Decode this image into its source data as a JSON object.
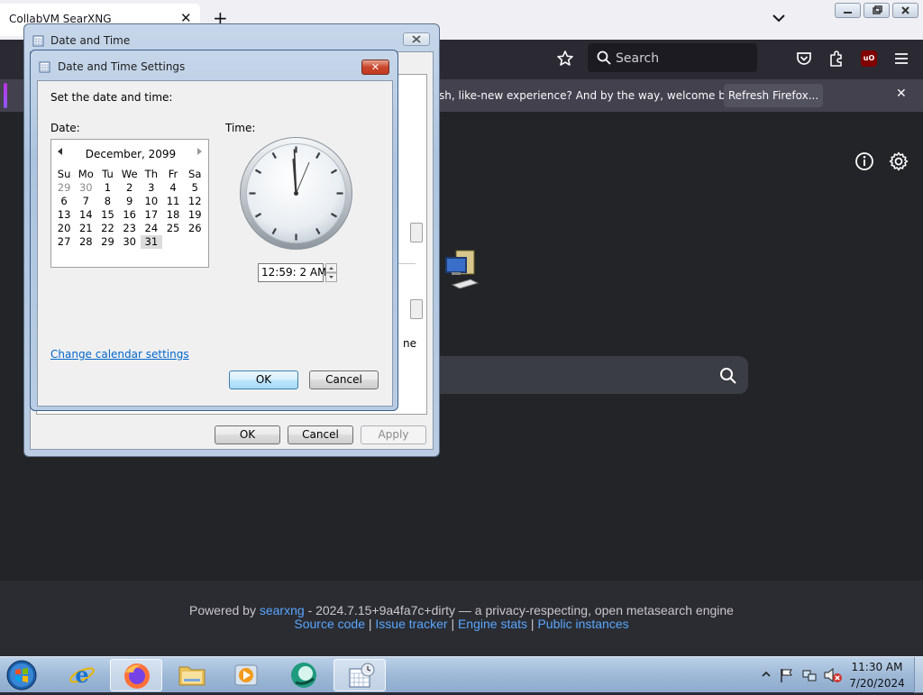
{
  "browser": {
    "tab_title": "CollabVM SearXNG",
    "search_placeholder": "Search",
    "ublock_label": "uO",
    "notification_text": "sh, like-new experience? And by the way, welcome back!",
    "refresh_button": "Refresh Firefox..."
  },
  "searxng": {
    "footer_prefix": "Powered by",
    "footer_link": "searxng",
    "footer_suffix": "- 2024.7.15+9a4fa7c+dirty — a privacy-respecting, open metasearch engine",
    "links": [
      "Source code",
      "Issue tracker",
      "Engine stats",
      "Public instances"
    ],
    "separator": "|"
  },
  "dialog_outer": {
    "title": "Date and Time",
    "partial_text": "ne",
    "ok": "OK",
    "cancel": "Cancel",
    "apply": "Apply"
  },
  "dialog_settings": {
    "title": "Date and Time Settings",
    "close_glyph": "✕",
    "prompt": "Set the date and time:",
    "date_label": "Date:",
    "time_label": "Time:",
    "calendar": {
      "month_year": "December, 2099",
      "weekdays": [
        "Su",
        "Mo",
        "Tu",
        "We",
        "Th",
        "Fr",
        "Sa"
      ],
      "weeks": [
        [
          "29",
          "30",
          "1",
          "2",
          "3",
          "4",
          "5"
        ],
        [
          "6",
          "7",
          "8",
          "9",
          "10",
          "11",
          "12"
        ],
        [
          "13",
          "14",
          "15",
          "16",
          "17",
          "18",
          "19"
        ],
        [
          "20",
          "21",
          "22",
          "23",
          "24",
          "25",
          "26"
        ],
        [
          "27",
          "28",
          "29",
          "30",
          "31",
          "",
          ""
        ]
      ],
      "selected_day": "31"
    },
    "time_value": "12:59: 2 AM",
    "change_calendar_link": "Change calendar settings",
    "ok": "OK",
    "cancel": "Cancel"
  },
  "taskbar": {
    "time": "11:30 AM",
    "date": "7/20/2024",
    "pinned": [
      "internet-explorer",
      "firefox",
      "file-explorer",
      "media-player",
      "collabvm",
      "date-time"
    ]
  },
  "colors": {
    "firefox_dark": "#2b2a33",
    "searxng_bg": "#222428",
    "link_blue": "#58a6ff"
  }
}
